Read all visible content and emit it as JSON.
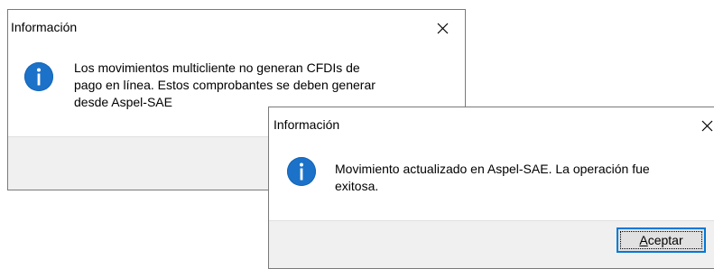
{
  "dialog_back": {
    "title": "Información",
    "close_symbol": "close-icon",
    "icon": "info-icon",
    "message_lines": [
      "Los movimientos multicliente no generan CFDIs de",
      "pago en línea. Estos comprobantes se deben generar",
      "desde Aspel-SAE"
    ]
  },
  "dialog_front": {
    "title": "Información",
    "close_symbol": "close-icon",
    "icon": "info-icon",
    "message_lines": [
      "Movimiento actualizado en Aspel-SAE. La operación fue",
      "exitosa."
    ],
    "ok_button": {
      "mnemonic": "A",
      "rest": "ceptar"
    }
  },
  "colors": {
    "info_icon": "#1c72c8",
    "footer": "#f0f0f0",
    "button_border": "#0078d7",
    "button_face": "#e1e1e1"
  }
}
